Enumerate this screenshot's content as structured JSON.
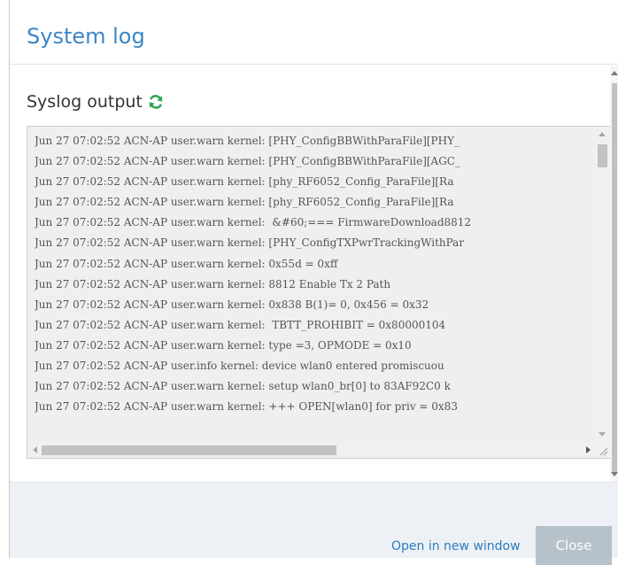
{
  "dialog": {
    "title": "System log",
    "section_heading": "Syslog output",
    "refresh_icon": "refresh-icon",
    "accent_color": "#3a86c8",
    "refresh_color": "#2fa84f"
  },
  "log": {
    "lines": [
      "Jun 27 07:02:52 ACN-AP user.warn kernel: [PHY_ConfigBBWithParaFile][PHY_",
      "Jun 27 07:02:52 ACN-AP user.warn kernel: [PHY_ConfigBBWithParaFile][AGC_",
      "Jun 27 07:02:52 ACN-AP user.warn kernel: [phy_RF6052_Config_ParaFile][Ra",
      "Jun 27 07:02:52 ACN-AP user.warn kernel: [phy_RF6052_Config_ParaFile][Ra",
      "Jun 27 07:02:52 ACN-AP user.warn kernel:  &#60;=== FirmwareDownload8812",
      "Jun 27 07:02:52 ACN-AP user.warn kernel: [PHY_ConfigTXPwrTrackingWithPar",
      "Jun 27 07:02:52 ACN-AP user.warn kernel: 0x55d = 0xff",
      "Jun 27 07:02:52 ACN-AP user.warn kernel: 8812 Enable Tx 2 Path",
      "Jun 27 07:02:52 ACN-AP user.warn kernel: 0x838 B(1)= 0, 0x456 = 0x32",
      "Jun 27 07:02:52 ACN-AP user.warn kernel:  TBTT_PROHIBIT = 0x80000104",
      "Jun 27 07:02:52 ACN-AP user.warn kernel: type =3, OPMODE = 0x10",
      "Jun 27 07:02:52 ACN-AP user.info kernel: device wlan0 entered promiscuou",
      "Jun 27 07:02:52 ACN-AP user.warn kernel: setup wlan0_br[0] to 83AF92C0 k",
      "Jun 27 07:02:52 ACN-AP user.warn kernel: +++ OPEN[wlan0] for priv = 0x83"
    ]
  },
  "footer": {
    "open_new_window": "Open in new window",
    "close": "Close"
  }
}
